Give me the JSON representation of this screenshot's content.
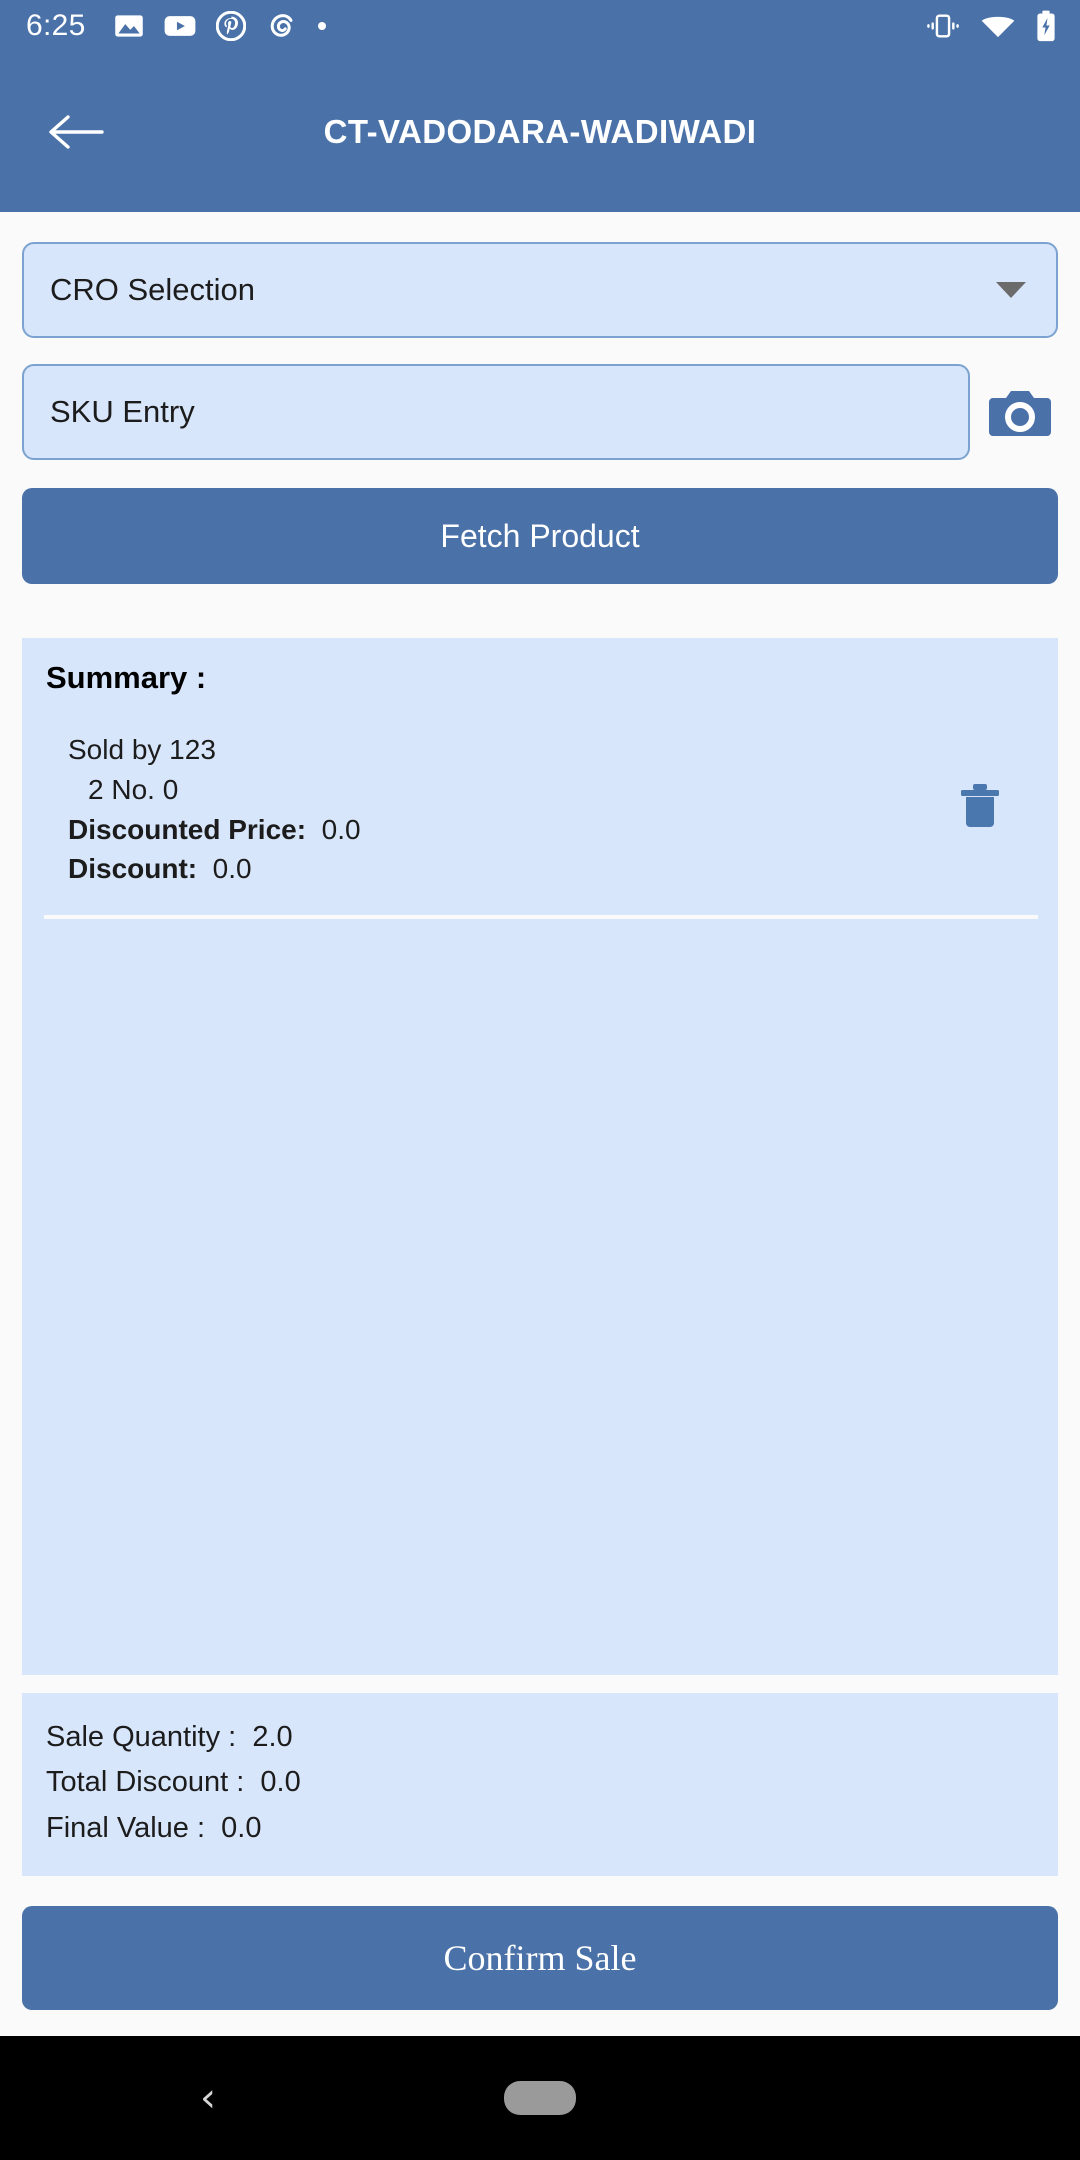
{
  "status_bar": {
    "time": "6:25",
    "left_icons": [
      "image-icon",
      "youtube-icon",
      "pinterest-icon",
      "spiral-icon",
      "dot-icon"
    ],
    "right_icons": [
      "vibrate-icon",
      "wifi-icon",
      "battery-charging-icon"
    ]
  },
  "app_bar": {
    "back_icon": "arrow-left-icon",
    "title": "CT-VADODARA-WADIWADI"
  },
  "form": {
    "cro_selection": {
      "label": "CRO Selection",
      "dropdown_icon": "chevron-down-icon"
    },
    "sku_entry": {
      "placeholder": "SKU Entry",
      "value": "",
      "camera_icon": "camera-icon"
    },
    "fetch_product_label": "Fetch Product"
  },
  "summary": {
    "title": "Summary  :",
    "items": [
      {
        "sold_by": "Sold by 123",
        "quantity_line": "2 No.   0",
        "discounted_price_label": "Discounted Price:",
        "discounted_price_value": "0.0",
        "discount_label": "Discount:",
        "discount_value": "0.0",
        "delete_icon": "trash-icon"
      }
    ]
  },
  "totals": {
    "sale_quantity_label": "Sale Quantity  :",
    "sale_quantity_value": "2.0",
    "total_discount_label": "Total Discount  :",
    "total_discount_value": "0.0",
    "final_value_label": "Final Value  :",
    "final_value_value": "0.0"
  },
  "confirm": {
    "label": "Confirm Sale"
  },
  "nav_bar": {
    "back_icon": "nav-back-icon",
    "home_pill_icon": "home-pill-icon"
  },
  "colors": {
    "primary": "#4a72a8",
    "panel": "#d8e6fb",
    "field_border": "#7ba2d0",
    "page_bg": "#fafafa"
  }
}
